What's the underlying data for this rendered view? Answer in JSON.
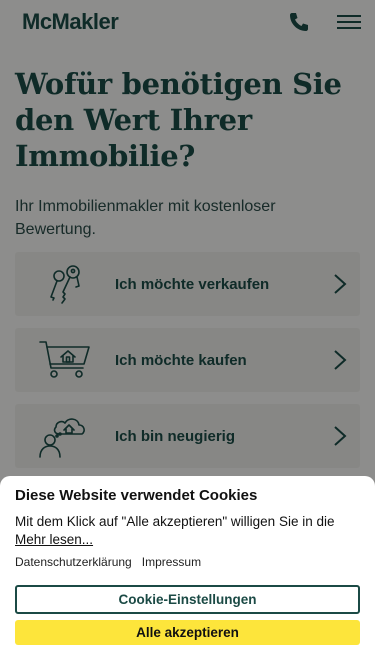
{
  "header": {
    "logo": "McMakler",
    "phone_icon": "phone-icon",
    "menu_icon": "hamburger-menu-icon"
  },
  "hero": {
    "title": "Wofür benötigen Sie den Wert Ihrer Immobilie?",
    "subtitle": "Ihr Immobilienmakler mit kostenloser Bewertung."
  },
  "options": [
    {
      "label": "Ich möchte verkaufen",
      "icon": "keys-icon"
    },
    {
      "label": "Ich möchte kaufen",
      "icon": "shopping-cart-house-icon"
    },
    {
      "label": "Ich bin neugierig",
      "icon": "person-cloud-house-icon"
    }
  ],
  "cookie": {
    "title": "Diese Website verwendet Cookies",
    "text": "Mit dem Klick auf \"Alle akzeptieren\" willigen Sie in die",
    "more": "Mehr lesen...",
    "privacy": "Datenschutzerklärung",
    "imprint": "Impressum",
    "settings_button": "Cookie-Einstellungen",
    "accept_button": "Alle akzeptieren"
  },
  "colors": {
    "brand_green": "#1b4a45",
    "accept_yellow": "#fde53b",
    "card_bg": "#e9e9e6",
    "page_bg": "#f3f3f1"
  }
}
